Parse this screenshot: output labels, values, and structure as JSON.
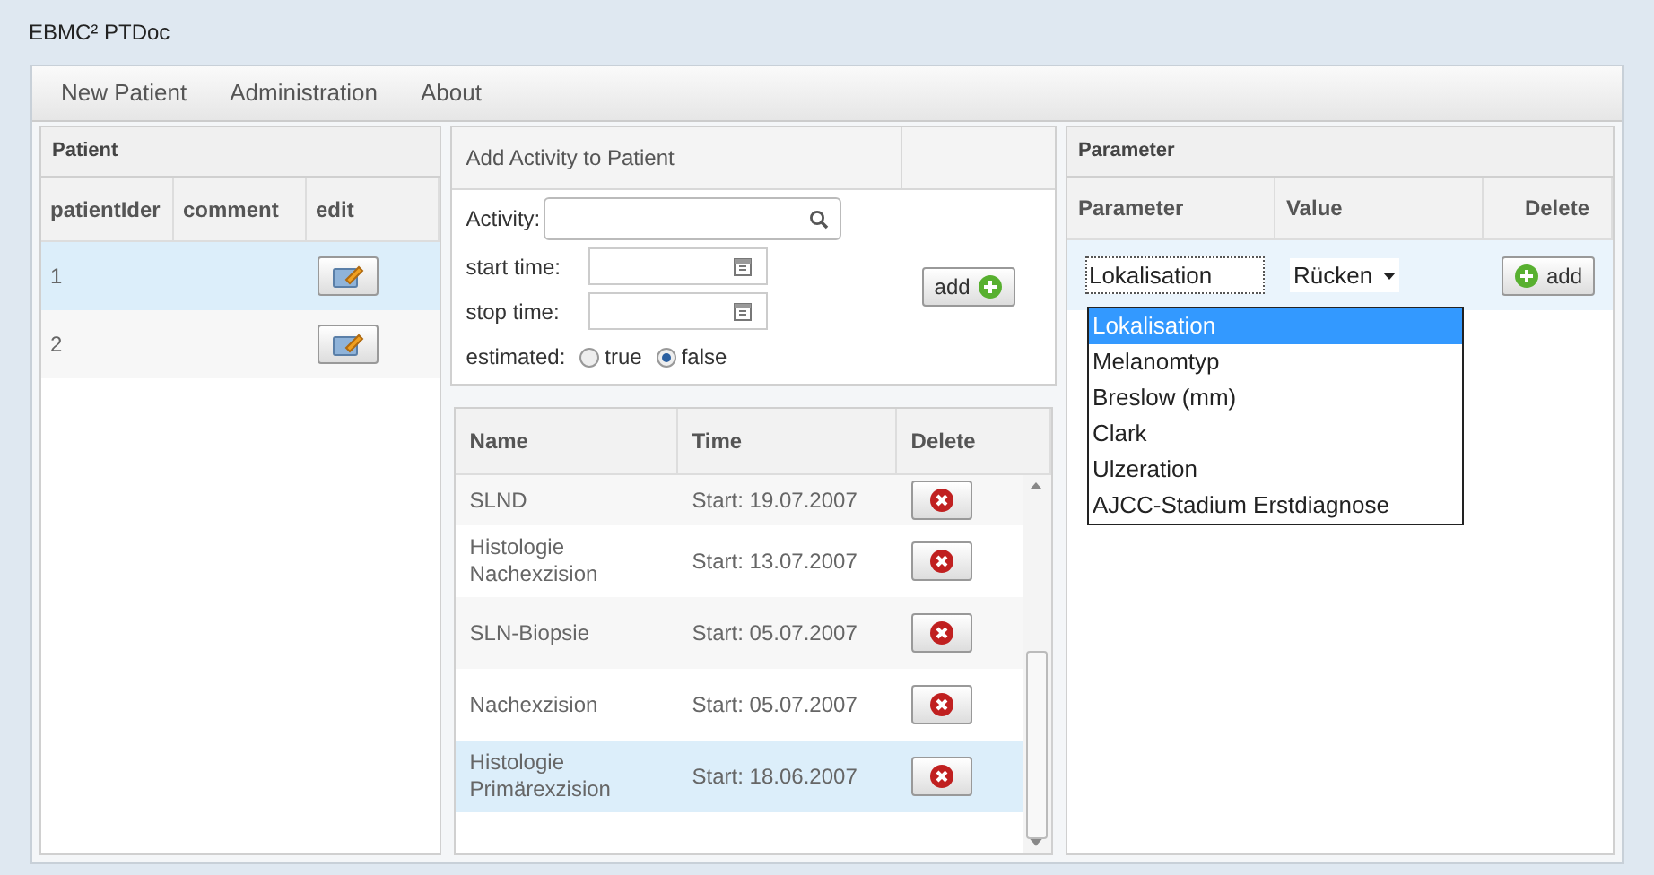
{
  "window": {
    "title": "EBMC² PTDoc"
  },
  "menu": [
    "New Patient",
    "Administration",
    "About"
  ],
  "patient_panel": {
    "title": "Patient",
    "columns": [
      "patientIder",
      "comment",
      "edit"
    ],
    "rows": [
      {
        "id": "1",
        "comment": "",
        "selected": true
      },
      {
        "id": "2",
        "comment": "",
        "selected": false
      }
    ]
  },
  "activity_form": {
    "title": "Add Activity to Patient",
    "activity_label": "Activity:",
    "start_label": "start time:",
    "stop_label": "stop time:",
    "estimated_label": "estimated:",
    "options": [
      {
        "label": "true",
        "selected": false
      },
      {
        "label": "false",
        "selected": true
      }
    ],
    "add_button": "add"
  },
  "activity_list": {
    "columns": [
      "Name",
      "Time",
      "Delete"
    ],
    "rows": [
      {
        "name": "SLND",
        "time": "Start: 19.07.2007",
        "selected": false
      },
      {
        "name": "Histologie Nachexzision",
        "time": "Start: 13.07.2007",
        "selected": false
      },
      {
        "name": "SLN-Biopsie",
        "time": "Start: 05.07.2007",
        "selected": false
      },
      {
        "name": "Nachexzision",
        "time": "Start: 05.07.2007",
        "selected": false
      },
      {
        "name": "Histologie Primärexzision",
        "time": "Start: 18.06.2007",
        "selected": true
      }
    ]
  },
  "parameter_panel": {
    "title": "Parameter",
    "columns": [
      "Parameter",
      "Value",
      "Delete"
    ],
    "parameter_value": "Lokalisation",
    "value": "Rücken",
    "add_button": "add",
    "dropdown": [
      {
        "label": "Lokalisation",
        "selected": true
      },
      {
        "label": "Melanomtyp",
        "selected": false
      },
      {
        "label": "Breslow (mm)",
        "selected": false
      },
      {
        "label": "Clark",
        "selected": false
      },
      {
        "label": "Ulzeration",
        "selected": false
      },
      {
        "label": "AJCC-Stadium Erstdiagnose",
        "selected": false
      }
    ]
  }
}
